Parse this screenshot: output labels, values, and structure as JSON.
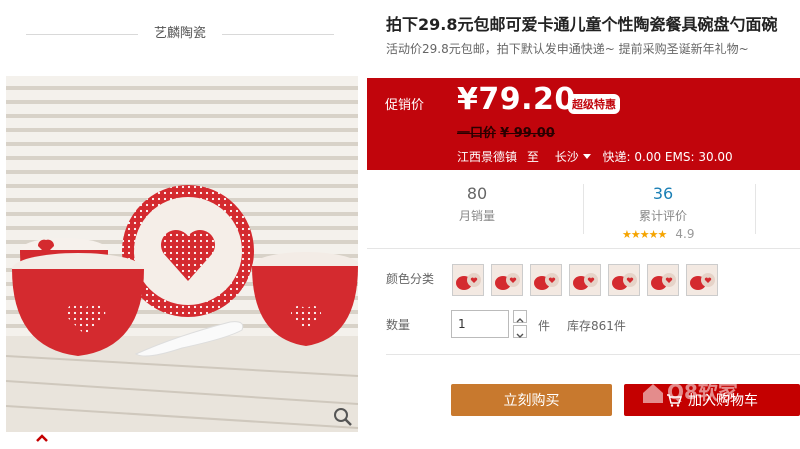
{
  "shop": {
    "name": "艺麟陶瓷"
  },
  "product": {
    "title": "拍下29.8元包邮可爱卡通儿童个性陶瓷餐具碗盘勺面碗",
    "subtitle": "活动价29.8元包邮，拍下默认发申通快递~ 提前采购圣诞新年礼物~"
  },
  "price": {
    "label": "促销价",
    "value": "¥79.20",
    "badge": "超级特惠",
    "original_label": "一口价",
    "original_value": "¥ 99.00"
  },
  "shipping": {
    "from": "江西景德镇",
    "to_word": "至",
    "destination": "长沙",
    "fees": "快递: 0.00 EMS: 30.00"
  },
  "stats": {
    "monthly_sales": "80",
    "monthly_sales_label": "月销量",
    "reviews": "36",
    "reviews_label": "累计评价",
    "stars": "★★★★★",
    "rating": "4.9"
  },
  "options": {
    "color_label": "颜色分类",
    "swatch_count": 7
  },
  "quantity": {
    "label": "数量",
    "value": "1",
    "unit": "件",
    "stock": "库存861件"
  },
  "actions": {
    "buy": "立刻购买",
    "cart": "加入购物车"
  },
  "watermark": {
    "text": "Q8软家"
  },
  "colors": {
    "accent": "#c1050c",
    "buy": "#c8792e",
    "cart": "#c40000",
    "star": "#f5a400",
    "link": "#1a7fb5"
  }
}
